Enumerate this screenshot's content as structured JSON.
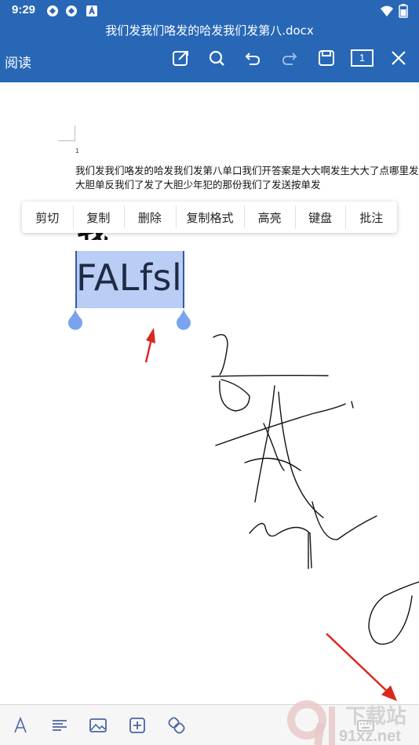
{
  "status": {
    "time": "9:29",
    "icons": [
      "sync-icon",
      "sync-icon",
      "notification-a-icon",
      "wifi-icon",
      "battery-icon"
    ]
  },
  "header": {
    "title": "我们发我们咯发的哈发我们发第八.docx",
    "mode_label": "阅读",
    "toolbar": {
      "edit": "edit-icon",
      "search": "search-icon",
      "undo": "undo-icon",
      "redo": "redo-icon",
      "save": "save-icon",
      "page_count": "1",
      "close": "close-icon"
    },
    "colors": {
      "accent": "#2767b6",
      "text": "#ffffff"
    }
  },
  "document": {
    "page_number": "1",
    "paragraph_lines": [
      "我们发我们咯发的哈发我们发第八单口我们开答案是大大啊发生大大了点哪里发",
      "大胆单反我们了发了大胆少年犯的那份我们了发送按单发"
    ],
    "partial_heading": "我",
    "selected_text": "FALfsl",
    "selection_color": "#b9cdf5",
    "handle_color": "#7aa3ef"
  },
  "context_menu": {
    "items": [
      "剪切",
      "复制",
      "删除",
      "复制格式",
      "高亮",
      "键盘",
      "批注"
    ]
  },
  "bottom_toolbar": {
    "items": [
      "text-format-icon",
      "paragraph-align-icon",
      "image-icon",
      "insert-icon",
      "link-icon",
      "keyboard-icon"
    ]
  },
  "watermark": {
    "text_big": "下载站",
    "text_small": "91xz.net",
    "logo": "9-logo-icon"
  },
  "annotations": {
    "arrow_color": "#d9281e"
  }
}
